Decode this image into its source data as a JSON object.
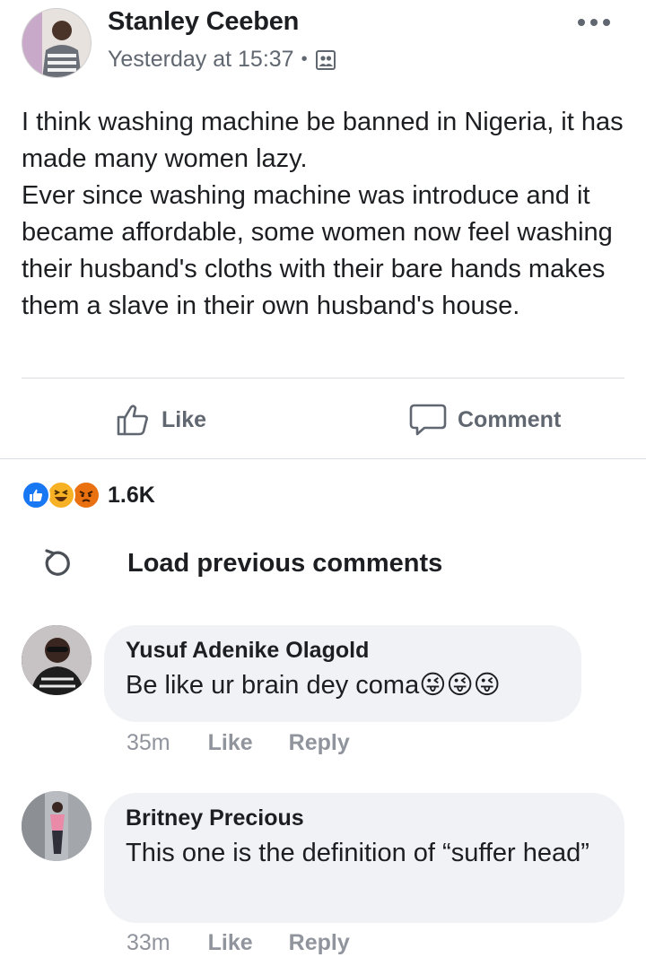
{
  "post": {
    "author": "Stanley Ceeben",
    "timestamp": "Yesterday at 15:37",
    "separator": "•",
    "audience_icon": "friends-of-friends-icon",
    "text_lines": [
      "I think washing machine be banned in Nigeria, it has made many women lazy.",
      "Ever since washing machine was introduce and it became affordable, some women now feel washing their husband's cloths with their bare hands makes them a slave in their own husband's house."
    ]
  },
  "actions": {
    "like_label": "Like",
    "comment_label": "Comment"
  },
  "reactions": {
    "types": [
      "like",
      "haha",
      "angry"
    ],
    "count": "1.6K"
  },
  "load_previous": {
    "label": "Load previous comments"
  },
  "comments": [
    {
      "author": "Yusuf Adenike Olagold",
      "text": "Be like ur brain dey coma😜😜😜",
      "time": "35m",
      "like_label": "Like",
      "reply_label": "Reply"
    },
    {
      "author": "Britney Precious",
      "text": "This one is the definition of “suffer head”",
      "time": "33m",
      "like_label": "Like",
      "reply_label": "Reply"
    }
  ],
  "colors": {
    "text_primary": "#1c1e21",
    "text_secondary": "#606770",
    "text_muted": "#90949c",
    "like_blue": "#1877f2",
    "haha_yellow": "#f7b125",
    "angry_orange": "#e9710f",
    "bubble_bg": "#f0f2f5"
  }
}
